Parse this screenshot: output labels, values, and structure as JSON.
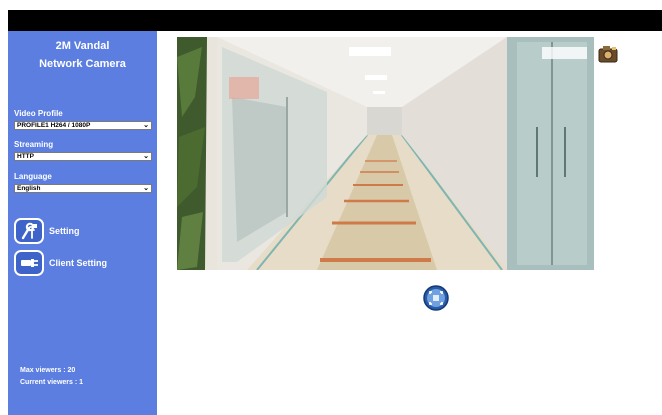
{
  "sidebar": {
    "brand_line1": "2M Vandal",
    "brand_line2": "Network Camera",
    "video_profile": {
      "label": "Video Profile",
      "selected": "PROFILE1 H264 / 1080P"
    },
    "streaming": {
      "label": "Streaming",
      "selected": "HTTP"
    },
    "language": {
      "label": "Language",
      "selected": "English"
    },
    "menu": [
      {
        "label": "Setting",
        "icon": "tools-icon"
      },
      {
        "label": "Client Setting",
        "icon": "plug-icon"
      }
    ],
    "max_viewers": "Max viewers : 20",
    "current_viewers": "Current viewers : 1"
  },
  "colors": {
    "sidebar_bg": "#5b7ee0",
    "top_bar": "#000000"
  },
  "icons": {
    "snapshot": "camera-icon",
    "fullscreen": "fullscreen-icon"
  }
}
